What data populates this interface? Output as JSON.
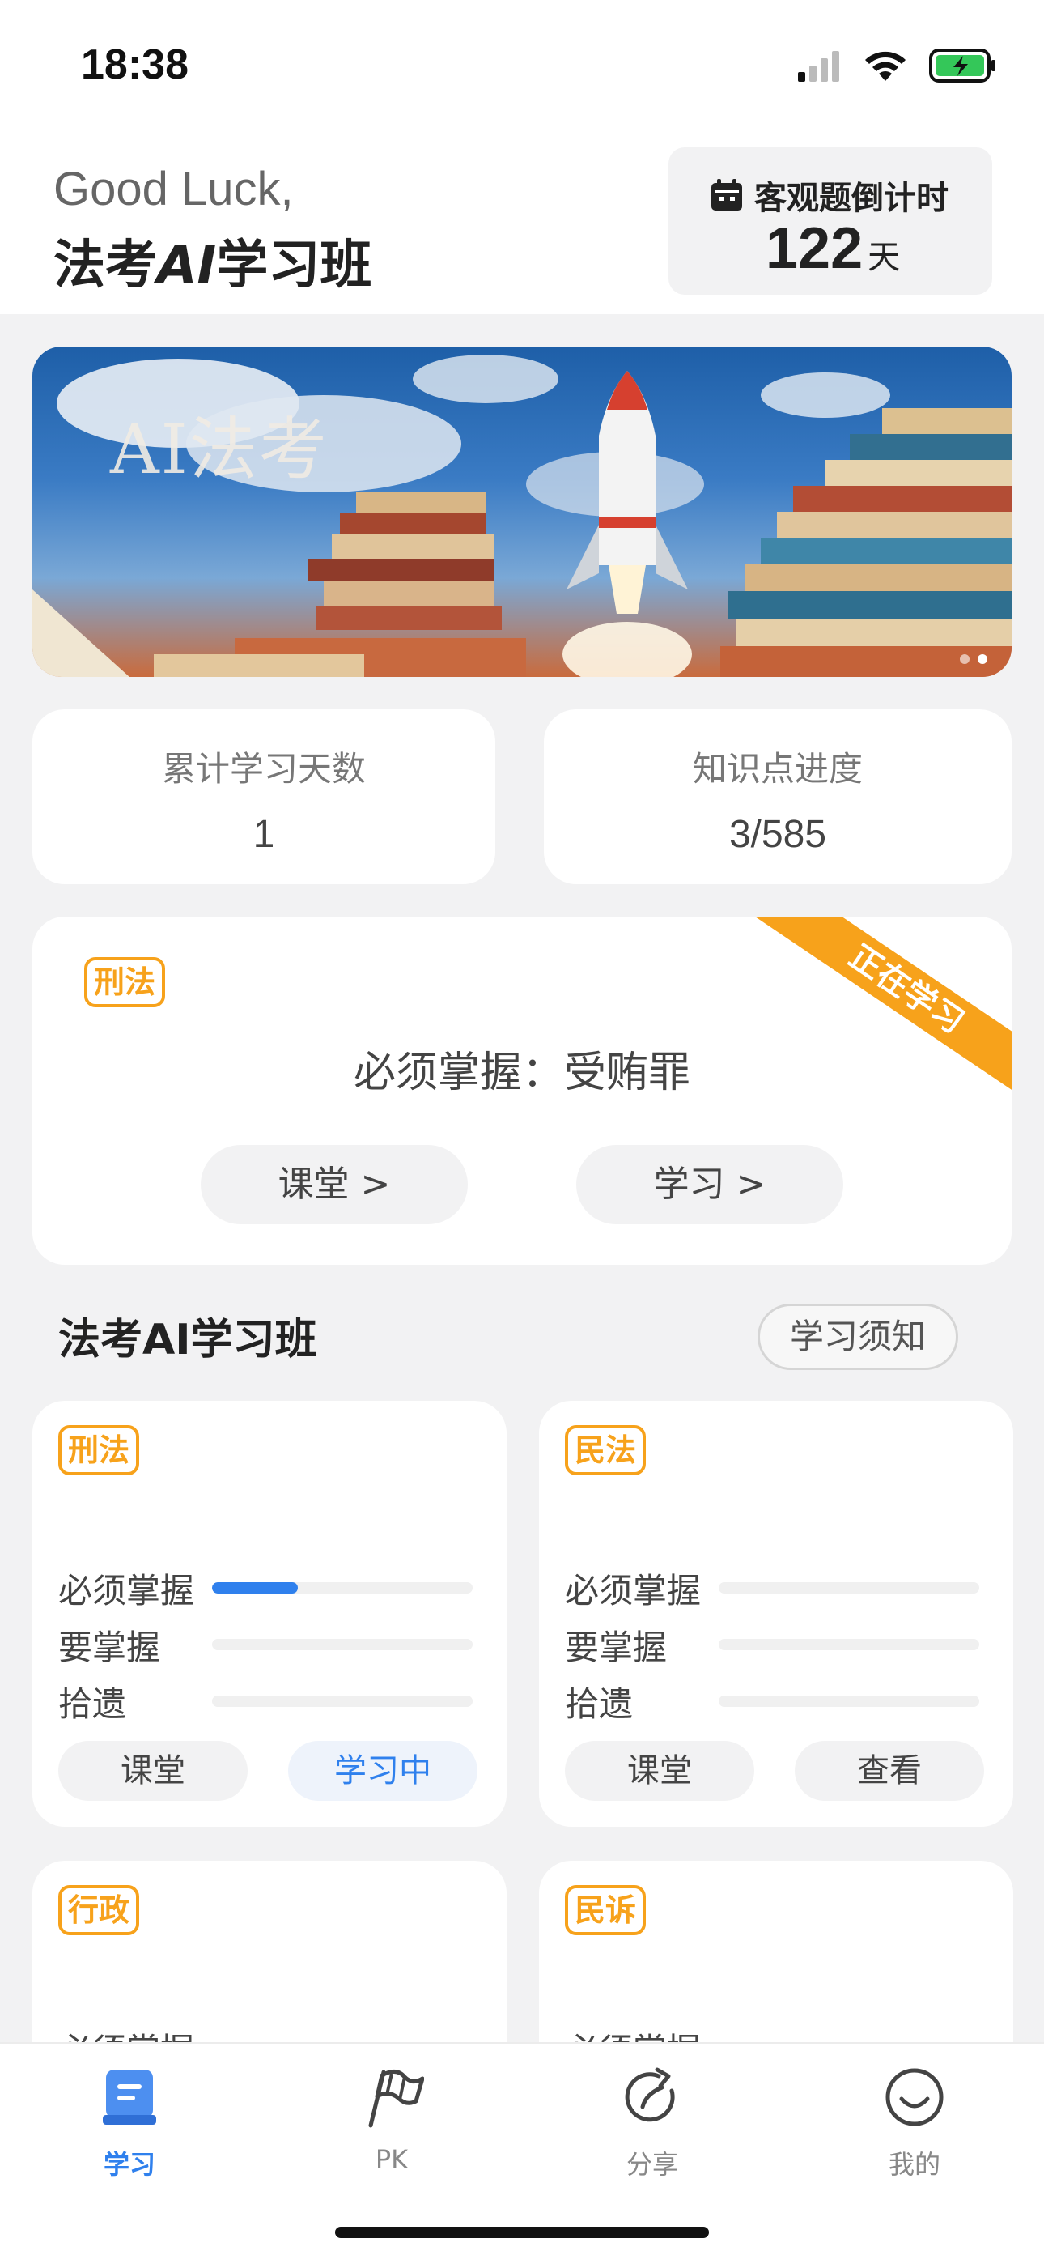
{
  "status_bar": {
    "time": "18:38"
  },
  "header": {
    "greeting": "Good Luck,",
    "class_title_prefix": "法考",
    "class_title_ai": "AI",
    "class_title_suffix": "学习班",
    "countdown_label": "客观题倒计时",
    "countdown_value": "122",
    "countdown_unit": "天"
  },
  "banner": {
    "title": "AI法考",
    "dots_total": 2,
    "active_dot": 2
  },
  "stats": [
    {
      "label": "累计学习天数",
      "value": "1"
    },
    {
      "label": "知识点进度",
      "value": "3/585"
    }
  ],
  "current": {
    "subject": "刑法",
    "ribbon": "正在学习",
    "topic": "必须掌握：受贿罪",
    "classroom_button": "课堂 >",
    "study_button": "学习 >"
  },
  "section": {
    "title": "法考AI学习班",
    "notice_button": "学习须知"
  },
  "progress_labels": [
    "必须掌握",
    "要掌握",
    "拾遗"
  ],
  "subjects": [
    {
      "name": "刑法",
      "progress": [
        0.33,
        0,
        0
      ],
      "left_button": "课堂",
      "right_button": "学习中",
      "right_active": true
    },
    {
      "name": "民法",
      "progress": [
        0,
        0,
        0
      ],
      "left_button": "课堂",
      "right_button": "查看",
      "right_active": false
    },
    {
      "name": "行政",
      "first_row_label": "必须掌握"
    },
    {
      "name": "民诉",
      "first_row_label": "必须掌握"
    }
  ],
  "tabs": [
    {
      "label": "学习",
      "icon": "book-icon",
      "active": true
    },
    {
      "label": "PK",
      "icon": "flag-icon",
      "active": false
    },
    {
      "label": "分享",
      "icon": "share-icon",
      "active": false
    },
    {
      "label": "我的",
      "icon": "smile-icon",
      "active": false
    }
  ],
  "colors": {
    "accent": "#2f80ed",
    "tag": "#f7a21b"
  }
}
